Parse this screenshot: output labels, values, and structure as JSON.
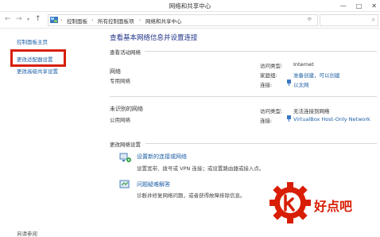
{
  "window": {
    "title": "网络和共享中心",
    "controls": [
      "—",
      "□",
      "✕"
    ]
  },
  "address": {
    "crumbs": [
      "控制面板",
      "所有控制面板项",
      "网络和共享中心"
    ],
    "separator": "›"
  },
  "left": {
    "items": [
      "控制面板主页",
      "更改适配器设置",
      "更改高级共享设置"
    ],
    "footer": "另请参阅"
  },
  "main": {
    "heading": "查看基本网络信息并设置连接",
    "active_section": "查看活动网络",
    "networks": [
      {
        "name": "网络",
        "category": "专用网络",
        "access_label": "访问类型:",
        "access_value": "Internet",
        "homegroup_label": "家庭组:",
        "homegroup_value": "准备创建，可以创建",
        "conn_label": "连接:",
        "conn_value": "以太网"
      },
      {
        "name": "未识别的网络",
        "category": "公用网络",
        "access_label": "访问类型:",
        "access_value": "无法连接到网络",
        "conn_label": "连接:",
        "conn_value": "VirtualBox Host-Only Network"
      }
    ],
    "change_section": "更改网络设置",
    "actions": [
      {
        "title": "设置新的连接或网络",
        "desc": "设置宽带、拨号或 VPN 连接；或设置路由器或接入点。"
      },
      {
        "title": "问题疑难解答",
        "desc": "诊断并修复网络问题，或者获得故障排除信息。"
      }
    ]
  },
  "watermark": {
    "text": "好点吧"
  },
  "colors": {
    "link": "#1e5fa6",
    "heading": "#1e3287",
    "highlight": "#d81e06"
  }
}
